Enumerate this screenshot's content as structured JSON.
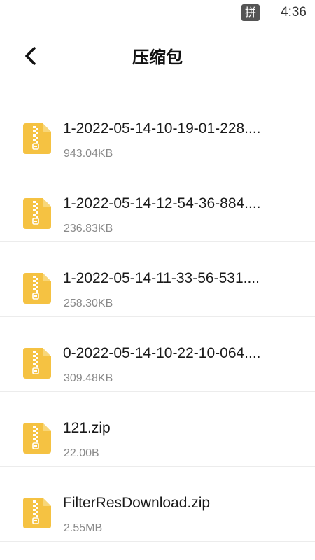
{
  "status_bar": {
    "ime_indicator": "拼",
    "time": "4:36"
  },
  "header": {
    "back_icon": "chevron-left-icon",
    "title": "压缩包"
  },
  "files": [
    {
      "name": "1-2022-05-14-10-19-01-228....",
      "size": "943.04KB",
      "icon": "zip-file-icon"
    },
    {
      "name": "1-2022-05-14-12-54-36-884....",
      "size": "236.83KB",
      "icon": "zip-file-icon"
    },
    {
      "name": "1-2022-05-14-11-33-56-531....",
      "size": "258.30KB",
      "icon": "zip-file-icon"
    },
    {
      "name": "0-2022-05-14-10-22-10-064....",
      "size": "309.48KB",
      "icon": "zip-file-icon"
    },
    {
      "name": "121.zip",
      "size": "22.00B",
      "icon": "zip-file-icon"
    },
    {
      "name": "FilterResDownload.zip",
      "size": "2.55MB",
      "icon": "zip-file-icon"
    }
  ],
  "colors": {
    "zip_icon": "#F5C242",
    "zip_icon_fold": "#F8D77A",
    "size_text": "#8a8a8a",
    "divider": "#ececec"
  }
}
